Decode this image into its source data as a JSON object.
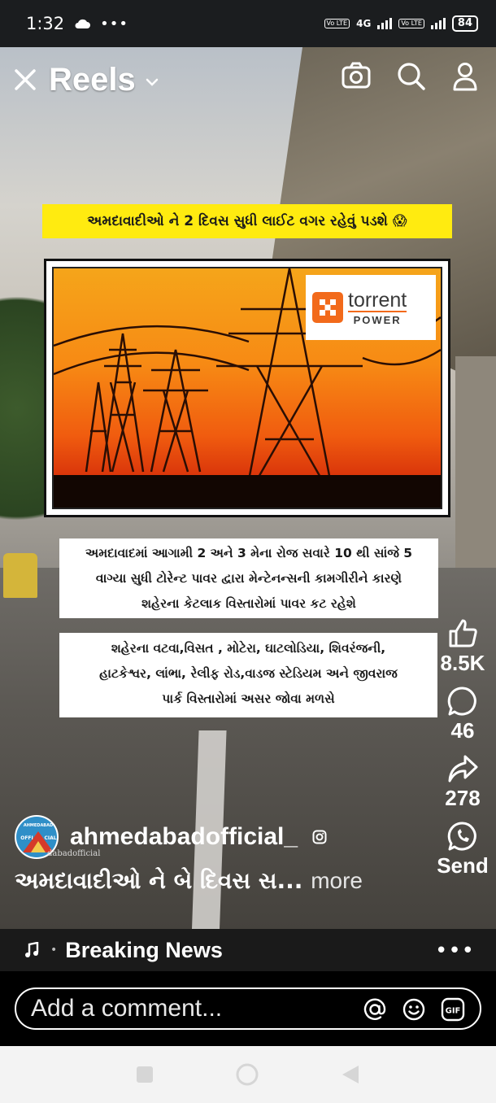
{
  "status": {
    "time": "1:32",
    "network": "4G",
    "volte": "Vo LTE",
    "battery": "84"
  },
  "header": {
    "title": "Reels"
  },
  "video": {
    "headline": "અમદાવાદીઓ ને 2 દિવસ સુધી લાઈટ વગર રહેવું પડશે 😱",
    "badge_word": "torrent",
    "badge_sub": "POWER",
    "caption1": [
      "અમદાવાદમાં આગામી 2 અને 3 મેના રોજ સવારે 10 થી સાંજે 5",
      "વાગ્યા સુધી ટોરેન્ટ પાવર દ્વારા મેન્ટેનન્સની કામગીરીને કારણે",
      "શહેરના કેટલાક વિસ્તારોમાં પાવર કટ  રહેશે"
    ],
    "caption2": [
      "શહેરના વટવા,વિસત , મોટેરા, ઘાટલોડિયા, શિવરંજની,",
      "હાટકેશ્વર, લાંભા, રેલીફ રોડ,વાડજ સ્ટેડિયમ અને જીવરાજ",
      "પાર્ક વિસ્તારોમાં અસર જોવા મળસે"
    ]
  },
  "actions": {
    "likes": "8.5K",
    "comments": "46",
    "shares": "278",
    "send": "Send"
  },
  "author": {
    "avatar_top": "AHMEDABAD",
    "avatar_mid": "OFFI",
    "avatar_mid2": "CIAL",
    "name": "ahmedabadofficial_",
    "watermark": "dabadofficial"
  },
  "caption": {
    "text": "અમદાવાદીઓ ને બે દિવસ સ...",
    "more": "more"
  },
  "music": {
    "label": "Breaking News"
  },
  "comment": {
    "placeholder": "Add a comment..."
  }
}
